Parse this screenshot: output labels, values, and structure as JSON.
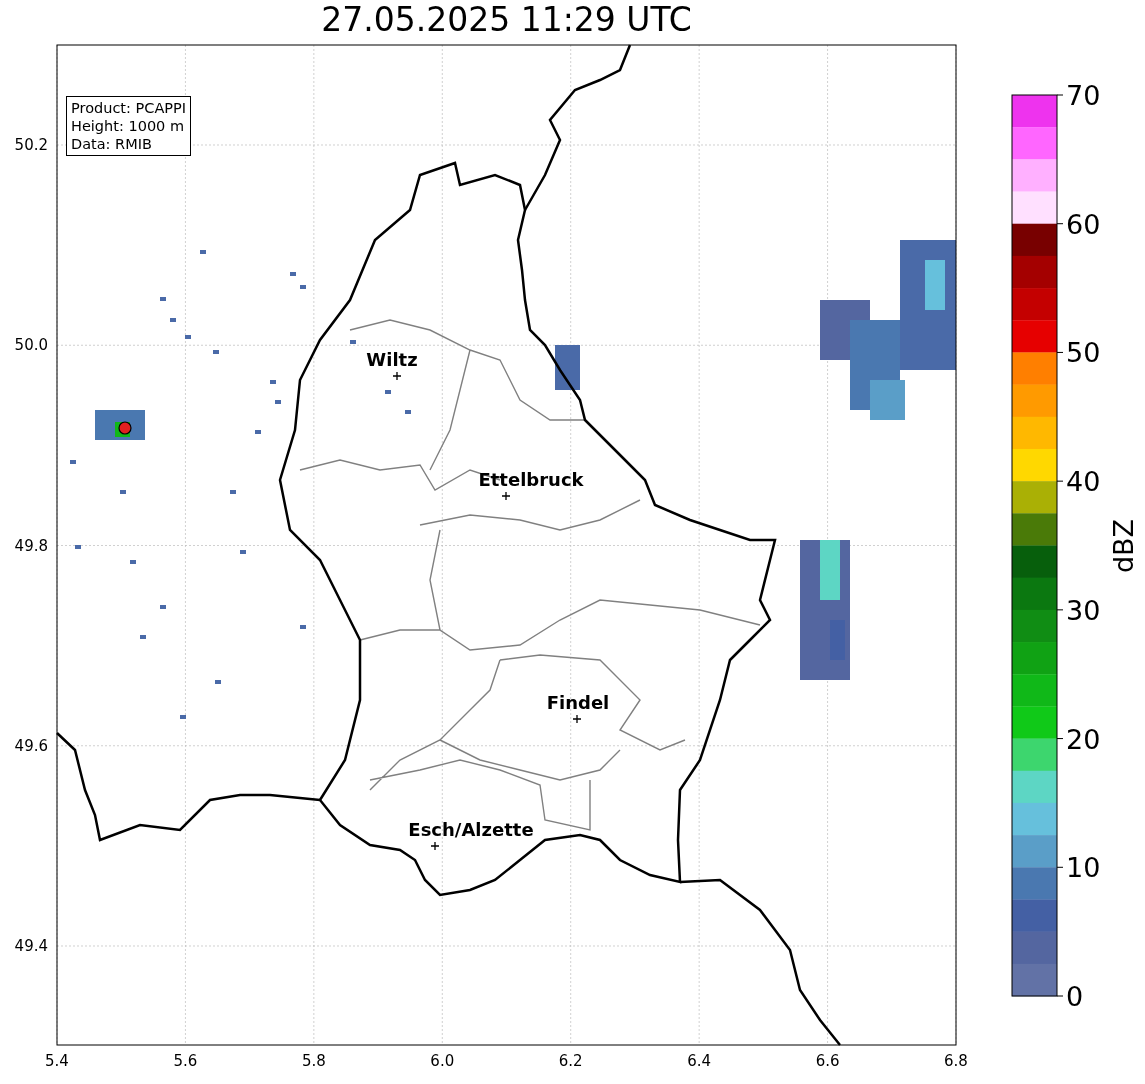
{
  "title": "27.05.2025 11:29 UTC",
  "info_box": [
    "Product: PCAPPI",
    "Height: 1000 m",
    "Data: RMIB"
  ],
  "x_ticks": [
    "5.4",
    "5.6",
    "5.8",
    "6.0",
    "6.2",
    "6.4",
    "6.6",
    "6.8"
  ],
  "y_ticks": [
    "50.2",
    "50.0",
    "49.8",
    "49.6",
    "49.4"
  ],
  "cities": [
    {
      "name": "Wiltz"
    },
    {
      "name": "Ettelbruck"
    },
    {
      "name": "Findel"
    },
    {
      "name": "Esch/Alzette"
    }
  ],
  "colorbar": {
    "label": "dBZ",
    "ticks": [
      "70",
      "60",
      "50",
      "40",
      "30",
      "20",
      "10",
      "0"
    ],
    "bins": [
      {
        "color": "#ee33ee"
      },
      {
        "color": "#ff66ff"
      },
      {
        "color": "#ffb0ff"
      },
      {
        "color": "#ffe0ff"
      },
      {
        "color": "#780000"
      },
      {
        "color": "#a40000"
      },
      {
        "color": "#c40000"
      },
      {
        "color": "#e60000"
      },
      {
        "color": "#ff7f00"
      },
      {
        "color": "#ff9a00"
      },
      {
        "color": "#ffb800"
      },
      {
        "color": "#ffd800"
      },
      {
        "color": "#aab005"
      },
      {
        "color": "#4a7a08"
      },
      {
        "color": "#075f0c"
      },
      {
        "color": "#0b7810"
      },
      {
        "color": "#108d14"
      },
      {
        "color": "#10a214"
      },
      {
        "color": "#10b818"
      },
      {
        "color": "#10c918"
      },
      {
        "color": "#3dd66e"
      },
      {
        "color": "#5dd6c4"
      },
      {
        "color": "#66c0dc"
      },
      {
        "color": "#5a9ec8"
      },
      {
        "color": "#4a78b0"
      },
      {
        "color": "#4460a4"
      },
      {
        "color": "#5466a0"
      },
      {
        "color": "#6272a6"
      }
    ]
  }
}
